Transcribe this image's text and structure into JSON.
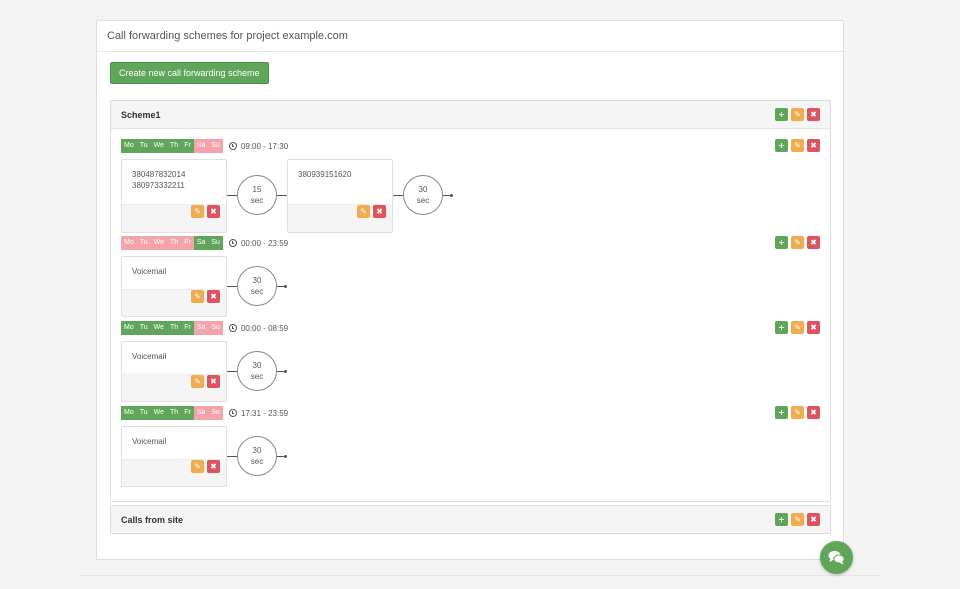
{
  "panel": {
    "title": "Call forwarding schemes for project example.com",
    "create_label": "Create new call forwarding scheme"
  },
  "colors": {
    "green": "#5fa65b",
    "orange": "#f0ad4e",
    "red": "#e0525c",
    "day_off_pink": "#f4a3ac"
  },
  "icons": {
    "add": "plus-icon",
    "edit": "pencil-icon",
    "delete": "close-icon",
    "time": "clock-icon",
    "chat": "chat-icon"
  },
  "glyphs": {
    "add": "+",
    "edit": "✎",
    "delete": "✖"
  },
  "schemes": [
    {
      "name": "Scheme1",
      "rules": [
        {
          "days": [
            {
              "label": "Mo",
              "active": true
            },
            {
              "label": "Tu",
              "active": true
            },
            {
              "label": "We",
              "active": true
            },
            {
              "label": "Th",
              "active": true
            },
            {
              "label": "Fr",
              "active": true
            },
            {
              "label": "Sa",
              "active": false
            },
            {
              "label": "Su",
              "active": false
            }
          ],
          "time": "09:00 - 17:30",
          "steps": [
            {
              "lines": [
                "380487832014",
                "380973332211"
              ],
              "delay_value": "15",
              "delay_unit": "sec"
            },
            {
              "lines": [
                "380939151620"
              ],
              "delay_value": "30",
              "delay_unit": "sec"
            }
          ]
        },
        {
          "days": [
            {
              "label": "Mo",
              "active": false
            },
            {
              "label": "Tu",
              "active": false
            },
            {
              "label": "We",
              "active": false
            },
            {
              "label": "Th",
              "active": false
            },
            {
              "label": "Fr",
              "active": false
            },
            {
              "label": "Sa",
              "active": true
            },
            {
              "label": "Su",
              "active": true
            }
          ],
          "time": "00:00 - 23:59",
          "steps": [
            {
              "lines": [
                "Voicemail"
              ],
              "delay_value": "30",
              "delay_unit": "sec"
            }
          ]
        },
        {
          "days": [
            {
              "label": "Mo",
              "active": true
            },
            {
              "label": "Tu",
              "active": true
            },
            {
              "label": "We",
              "active": true
            },
            {
              "label": "Th",
              "active": true
            },
            {
              "label": "Fr",
              "active": true
            },
            {
              "label": "Sa",
              "active": false
            },
            {
              "label": "Su",
              "active": false
            }
          ],
          "time": "00:00 - 08:59",
          "steps": [
            {
              "lines": [
                "Voicemail"
              ],
              "delay_value": "30",
              "delay_unit": "sec"
            }
          ]
        },
        {
          "days": [
            {
              "label": "Mo",
              "active": true
            },
            {
              "label": "Tu",
              "active": true
            },
            {
              "label": "We",
              "active": true
            },
            {
              "label": "Th",
              "active": true
            },
            {
              "label": "Fr",
              "active": true
            },
            {
              "label": "Sa",
              "active": false
            },
            {
              "label": "Su",
              "active": false
            }
          ],
          "time": "17:31 - 23:59",
          "steps": [
            {
              "lines": [
                "Voicemail"
              ],
              "delay_value": "30",
              "delay_unit": "sec"
            }
          ]
        }
      ]
    },
    {
      "name": "Calls from site",
      "rules": []
    }
  ]
}
